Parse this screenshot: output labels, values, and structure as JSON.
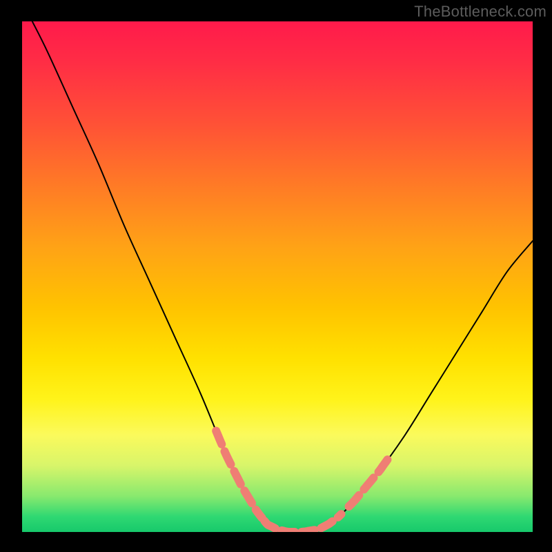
{
  "watermark": "TheBottleneck.com",
  "chart_data": {
    "type": "line",
    "title": "",
    "xlabel": "",
    "ylabel": "",
    "xlim": [
      0,
      100
    ],
    "ylim": [
      0,
      100
    ],
    "grid": false,
    "legend": false,
    "series": [
      {
        "name": "curve",
        "x": [
          2,
          5,
          10,
          15,
          20,
          25,
          30,
          35,
          40,
          43,
          46,
          48,
          50,
          52,
          55,
          58,
          60,
          62,
          65,
          70,
          75,
          80,
          85,
          90,
          95,
          100
        ],
        "y": [
          100,
          94,
          83,
          72,
          60,
          49,
          38,
          27,
          15,
          9,
          4,
          1.5,
          0.5,
          0,
          0,
          0.5,
          1.5,
          3,
          6,
          12,
          19,
          27,
          35,
          43,
          51,
          57
        ]
      }
    ],
    "highlight_segments": {
      "description": "Salmon dashed thick overlay markers on flanks and valley floor",
      "color": "#ef7e74",
      "stroke_width": 12,
      "dash": "20 10",
      "ranges_x": [
        [
          38,
          47
        ],
        [
          47.5,
          63
        ],
        [
          64,
          72
        ]
      ]
    },
    "background_gradient": {
      "direction": "top-to-bottom",
      "stops": [
        {
          "pos": 0.0,
          "color": "#ff1a4b"
        },
        {
          "pos": 0.3,
          "color": "#ff7a26"
        },
        {
          "pos": 0.6,
          "color": "#ffd400"
        },
        {
          "pos": 0.8,
          "color": "#fbfa5c"
        },
        {
          "pos": 1.0,
          "color": "#17c96b"
        }
      ]
    }
  }
}
